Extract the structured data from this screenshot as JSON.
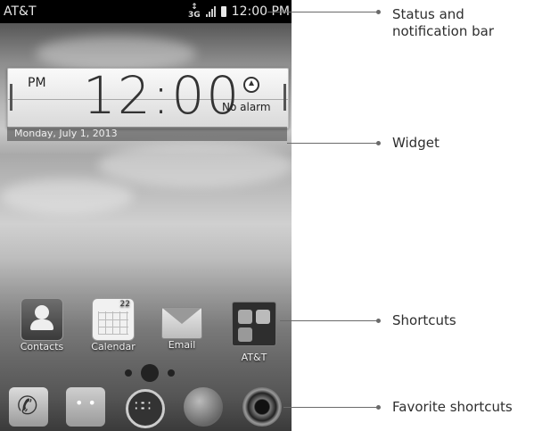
{
  "status_bar": {
    "carrier": "AT&T",
    "network": "3G",
    "time": "12:00 PM"
  },
  "widget": {
    "ampm": "PM",
    "time": "12:00",
    "alarm_text": "No alarm",
    "date": "Monday, July 1, 2013"
  },
  "shortcuts": [
    {
      "label": "Contacts",
      "icon": "contacts-icon"
    },
    {
      "label": "Calendar",
      "icon": "calendar-icon"
    },
    {
      "label": "Email",
      "icon": "email-icon"
    },
    {
      "label": "AT&T",
      "icon": "att-folder-icon"
    }
  ],
  "dock": [
    {
      "icon": "phone-icon"
    },
    {
      "icon": "messaging-icon"
    },
    {
      "icon": "apps-icon"
    },
    {
      "icon": "browser-icon"
    },
    {
      "icon": "camera-icon"
    }
  ],
  "callouts": {
    "status_line1": "Status and",
    "status_line2": "notification bar",
    "widget": "Widget",
    "shortcuts": "Shortcuts",
    "favorites": "Favorite shortcuts"
  }
}
